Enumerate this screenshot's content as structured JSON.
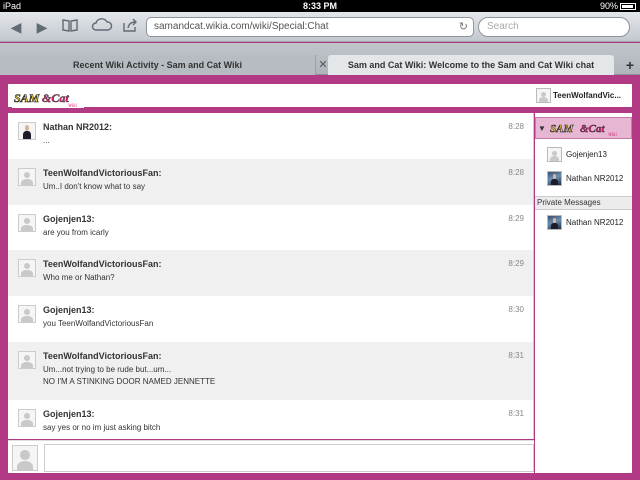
{
  "status_bar": {
    "device": "iPad",
    "time": "8:33 PM",
    "battery": "90%"
  },
  "browser": {
    "url": "samandcat.wikia.com/wiki/Special:Chat",
    "search_placeholder": "Search",
    "tabs": [
      {
        "label": "Recent Wiki Activity - Sam and Cat Wiki"
      },
      {
        "label": "Sam and Cat Wiki: Welcome to the Sam and Cat Wiki chat"
      }
    ]
  },
  "header": {
    "current_user": "TeenWolfandVic..."
  },
  "messages": [
    {
      "user": "Nathan NR2012:",
      "time": "8:28",
      "text": "...",
      "avatar": "photo"
    },
    {
      "user": "TeenWolfandVictoriousFan:",
      "time": "8:28",
      "text": "Um..I don't know what to say",
      "avatar": "default"
    },
    {
      "user": "Gojenjen13:",
      "time": "8:29",
      "text": "are you from icarly",
      "avatar": "default"
    },
    {
      "user": "TeenWolfandVictoriousFan:",
      "time": "8:29",
      "text": "Who me or Nathan?",
      "avatar": "default"
    },
    {
      "user": "Gojenjen13:",
      "time": "8:30",
      "text": "you TeenWolfandVictoriousFan",
      "avatar": "default"
    },
    {
      "user": "TeenWolfandVictoriousFan:",
      "time": "8:31",
      "text": "Um...not trying to be rude but...um...\nNO I'M A STINKING DOOR NAMED JENNETTE",
      "avatar": "default"
    },
    {
      "user": "Gojenjen13:",
      "time": "8:31",
      "text": "say yes or no im just asking bitch",
      "avatar": "default"
    }
  ],
  "sidebar": {
    "users": [
      {
        "name": "Gojenjen13",
        "avatar": "default"
      },
      {
        "name": "Nathan NR2012",
        "avatar": "photo"
      }
    ],
    "private_messages_label": "Private Messages",
    "private_messages": [
      {
        "name": "Nathan NR2012",
        "avatar": "photo"
      }
    ]
  },
  "colors": {
    "frame": "#b23a85",
    "room_highlight": "#e6b6d3"
  },
  "logo_text": "SAM & Cat Wiki"
}
